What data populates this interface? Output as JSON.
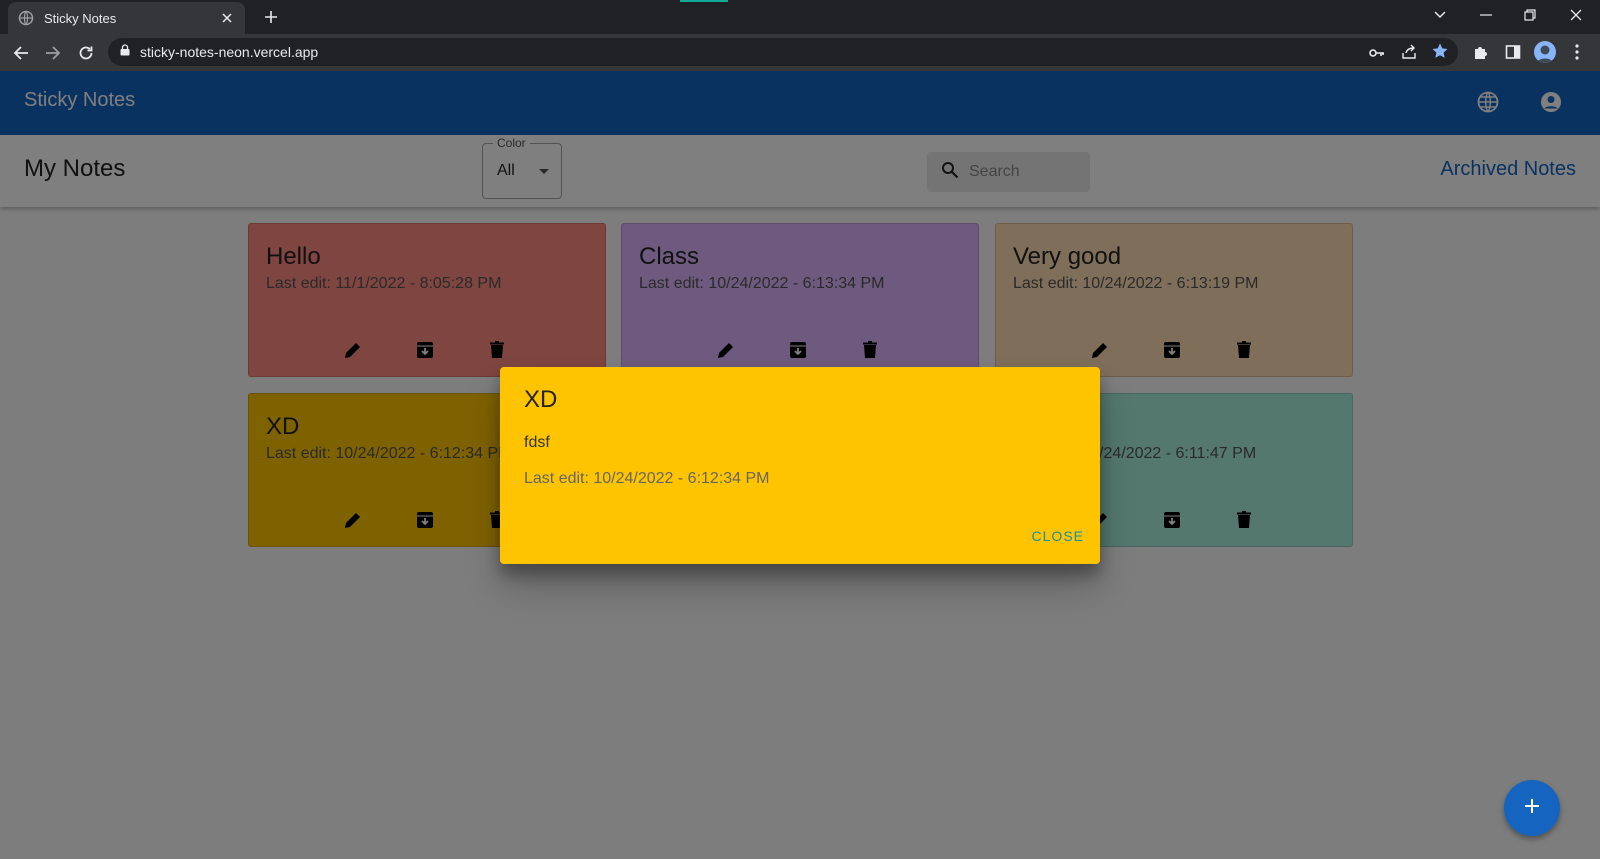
{
  "browser": {
    "tab_title": "Sticky Notes",
    "url": "sticky-notes-neon.vercel.app"
  },
  "app": {
    "title": "Sticky Notes",
    "brand_color": "#1565c0",
    "icons": [
      "globe-icon",
      "account-circle-icon"
    ]
  },
  "toolbar": {
    "page_title": "My Notes",
    "color_filter": {
      "label": "Color",
      "value": "All"
    },
    "search": {
      "placeholder": "Search"
    },
    "archived_link": "Archived Notes"
  },
  "notes": [
    {
      "title": "Hello",
      "date": "Last edit: 11/1/2022 - 8:05:28 PM",
      "color": "#ff8a80"
    },
    {
      "title": "Class",
      "date": "Last edit: 10/24/2022 - 6:13:34 PM",
      "color": "#dcb4ff"
    },
    {
      "title": "Very good",
      "date": "Last edit: 10/24/2022 - 6:13:19 PM",
      "color": "#ffdcb4"
    },
    {
      "title": "XD",
      "date": "Last edit: 10/24/2022 - 6:12:34 PM",
      "color": "#ffc400"
    },
    {
      "title": "",
      "date": "/24/2022 - 6:11:47 PM",
      "color": "#a8f0dc"
    }
  ],
  "dialog": {
    "title": "XD",
    "body": "fdsf",
    "date": "Last edit: 10/24/2022 - 6:12:34 PM",
    "close_label": "CLOSE",
    "color": "#ffc400"
  },
  "fab": {
    "label": "+",
    "color": "#1565c0"
  }
}
